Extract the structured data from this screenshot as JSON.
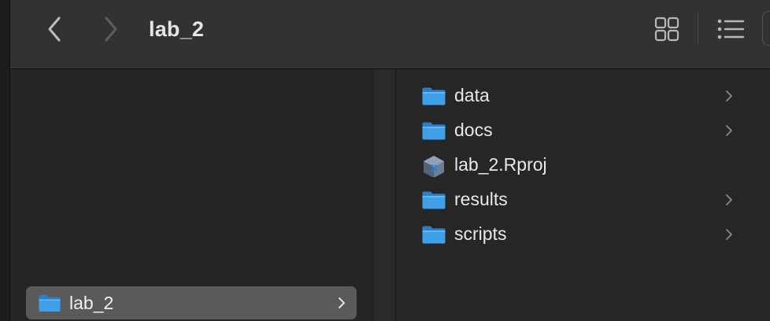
{
  "window": {
    "title": "lab_2",
    "icons": {
      "back": "chevron-left-icon",
      "forward": "chevron-right-icon",
      "grid_view": "grid-view-icon",
      "list_view": "list-view-icon"
    }
  },
  "sidebar_column": {
    "selected_item": {
      "label": "lab_2",
      "icon": "folder-icon"
    }
  },
  "content_column": {
    "items": [
      {
        "label": "data",
        "type": "folder",
        "icon": "folder-icon"
      },
      {
        "label": "docs",
        "type": "folder",
        "icon": "folder-icon"
      },
      {
        "label": "lab_2.Rproj",
        "type": "file",
        "icon": "rproj-file-icon"
      },
      {
        "label": "results",
        "type": "folder",
        "icon": "folder-icon"
      },
      {
        "label": "scripts",
        "type": "folder",
        "icon": "folder-icon"
      }
    ]
  },
  "colors": {
    "toolbar_bg": "#323232",
    "window_bg": "#262626",
    "selection_bg": "#5a5a5a",
    "folder_blue": "#3fa0e8",
    "text": "#e8e8e8"
  }
}
